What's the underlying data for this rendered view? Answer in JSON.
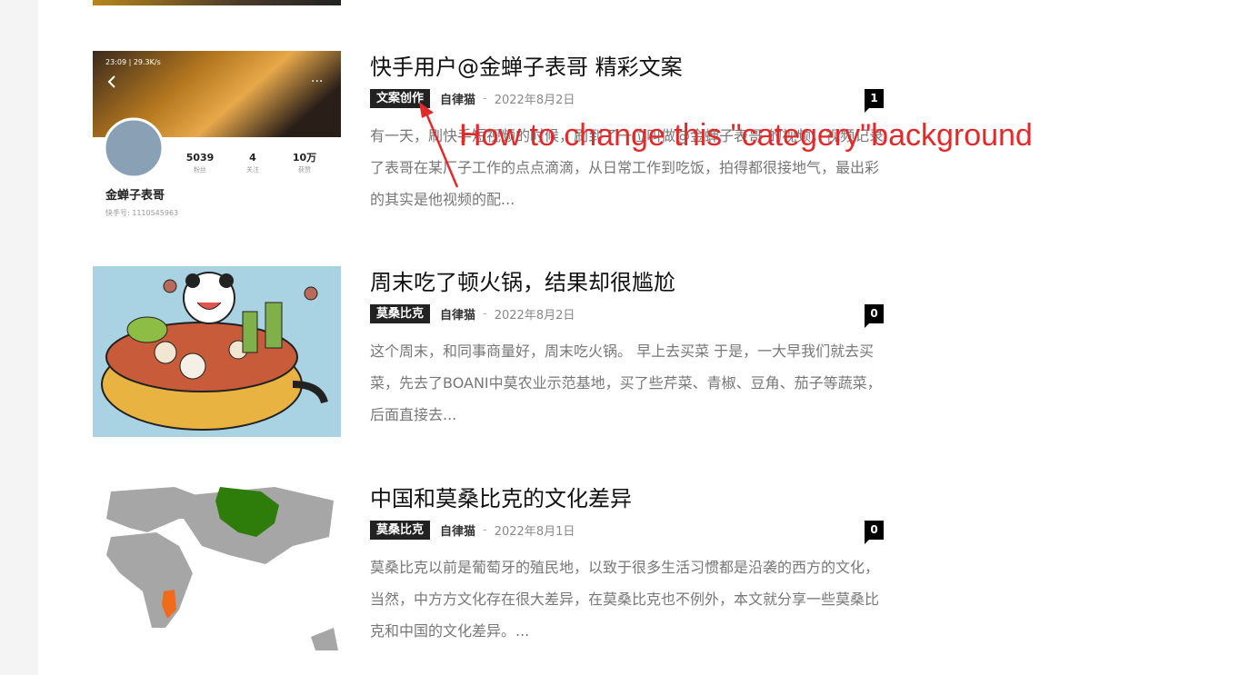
{
  "posts": [
    {
      "title": "快手用户@金蝉子表哥 精彩文案",
      "category": "文案创作",
      "author": "自律猫",
      "sep": "-",
      "date": "2022年8月2日",
      "comments": "1",
      "excerpt": "有一天，刷快手短视频的时候，刷到了一位叫做@金蝉子表哥 的视频，视频记录了表哥在某厂子工作的点点滴滴，从日常工作到吃饭，拍得都很接地气，最出彩的其实是他视频的配...",
      "thumb": {
        "status_time": "23:09 | 29.3K/s",
        "stat1_value": "5039",
        "stat1_label": "粉丝",
        "stat2_value": "4",
        "stat2_label": "关注",
        "stat3_value": "10万",
        "stat3_label": "获赞",
        "name": "金蝉子表哥",
        "id_text": "快手号: 1110545963"
      }
    },
    {
      "title": "周末吃了顿火锅，结果却很尴尬",
      "category": "莫桑比克",
      "author": "自律猫",
      "sep": "-",
      "date": "2022年8月2日",
      "comments": "0",
      "excerpt": "这个周末，和同事商量好，周末吃火锅。 早上去买菜 于是，一大早我们就去买菜，先去了BOANI中莫农业示范基地，买了些芹菜、青椒、豆角、茄子等蔬菜，后面直接去..."
    },
    {
      "title": "中国和莫桑比克的文化差异",
      "category": "莫桑比克",
      "author": "自律猫",
      "sep": "-",
      "date": "2022年8月1日",
      "comments": "0",
      "excerpt": "莫桑比克以前是葡萄牙的殖民地，以致于很多生活习惯都是沿袭的西方的文化，当然，中方方文化存在很大差异，在莫桑比克也不例外，本文就分享一些莫桑比克和中国的文化差异。..."
    }
  ],
  "annotation": "How to change this \"categery\"background",
  "colors": {
    "category_bg": "#222222",
    "annotation": "#e22a2a",
    "china_green": "#2e7d0a",
    "mozambique_orange": "#f26b1d"
  }
}
